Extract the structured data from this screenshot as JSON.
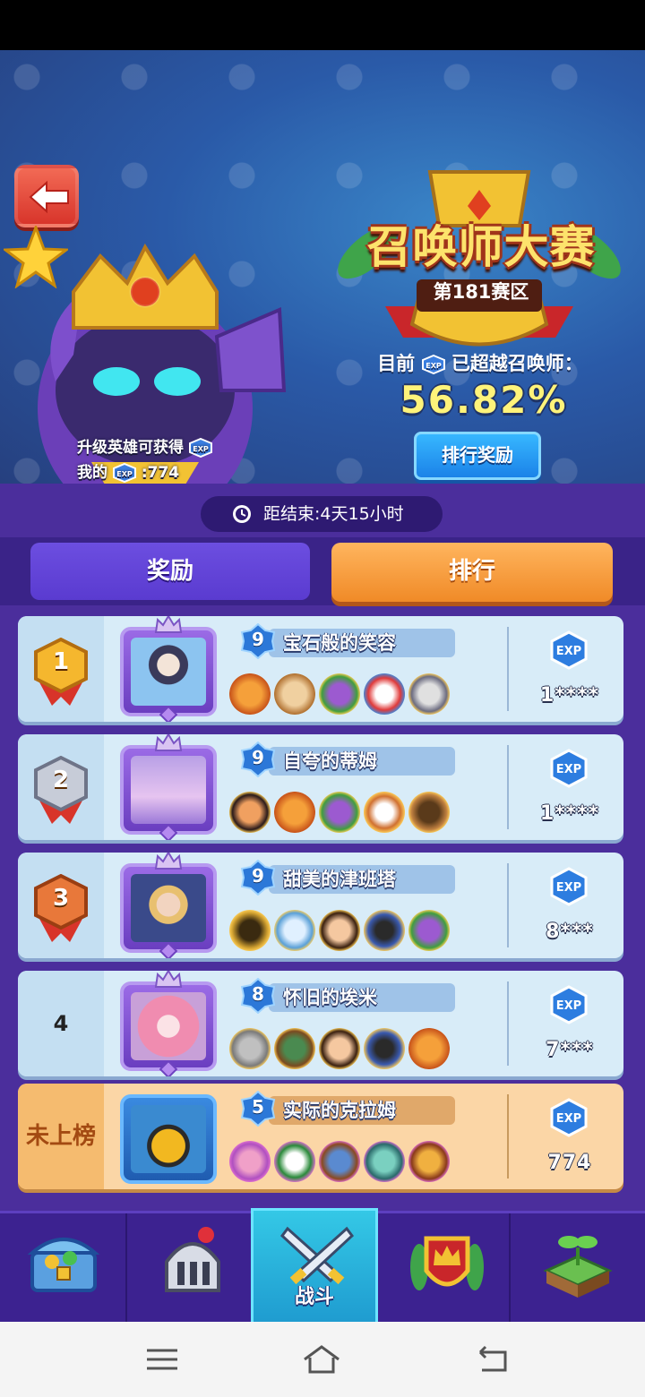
{
  "header": {
    "title": "召唤师大赛",
    "season": "第181赛区",
    "surpass_prefix": "目前",
    "surpass_suffix": "已超越召唤师：",
    "percent": "56.82%",
    "rank_reward_button": "排行奖励",
    "hero_note_line1": "升级英雄可获得",
    "my_exp_label": "我的",
    "my_exp_value": ":774"
  },
  "timer": {
    "text": "距结束:4天15小时"
  },
  "tabs": [
    {
      "label": "奖励",
      "active": false
    },
    {
      "label": "排行",
      "active": true
    }
  ],
  "leaderboard": [
    {
      "rank": "1",
      "level": "9",
      "name": "宝石般的笑容",
      "exp": "1****"
    },
    {
      "rank": "2",
      "level": "9",
      "name": "自夸的蒂姆",
      "exp": "1****"
    },
    {
      "rank": "3",
      "level": "9",
      "name": "甜美的津班塔",
      "exp": "8***"
    },
    {
      "rank": "4",
      "level": "8",
      "name": "怀旧的埃米",
      "exp": "7***"
    }
  ],
  "me": {
    "rank": "未上榜",
    "level": "5",
    "name": "实际的克拉姆",
    "exp": "774"
  },
  "exp_badge_text": "EXP",
  "bottom_nav": [
    {
      "icon": "treasure-chest-icon",
      "label": ""
    },
    {
      "icon": "knight-helmet-icon",
      "label": ""
    },
    {
      "icon": "crossed-swords-icon",
      "label": "战斗",
      "active": true
    },
    {
      "icon": "crown-shield-icon",
      "label": ""
    },
    {
      "icon": "sprout-island-icon",
      "label": ""
    }
  ],
  "colors": {
    "main_bg": "#4b2e9c",
    "rank_tab_active": "#f08a27",
    "reward_tab": "#5a3bd0",
    "card_bg": "#d8ecf8",
    "my_card_bg": "#fbd6a6",
    "percent_color": "#fff37a"
  }
}
